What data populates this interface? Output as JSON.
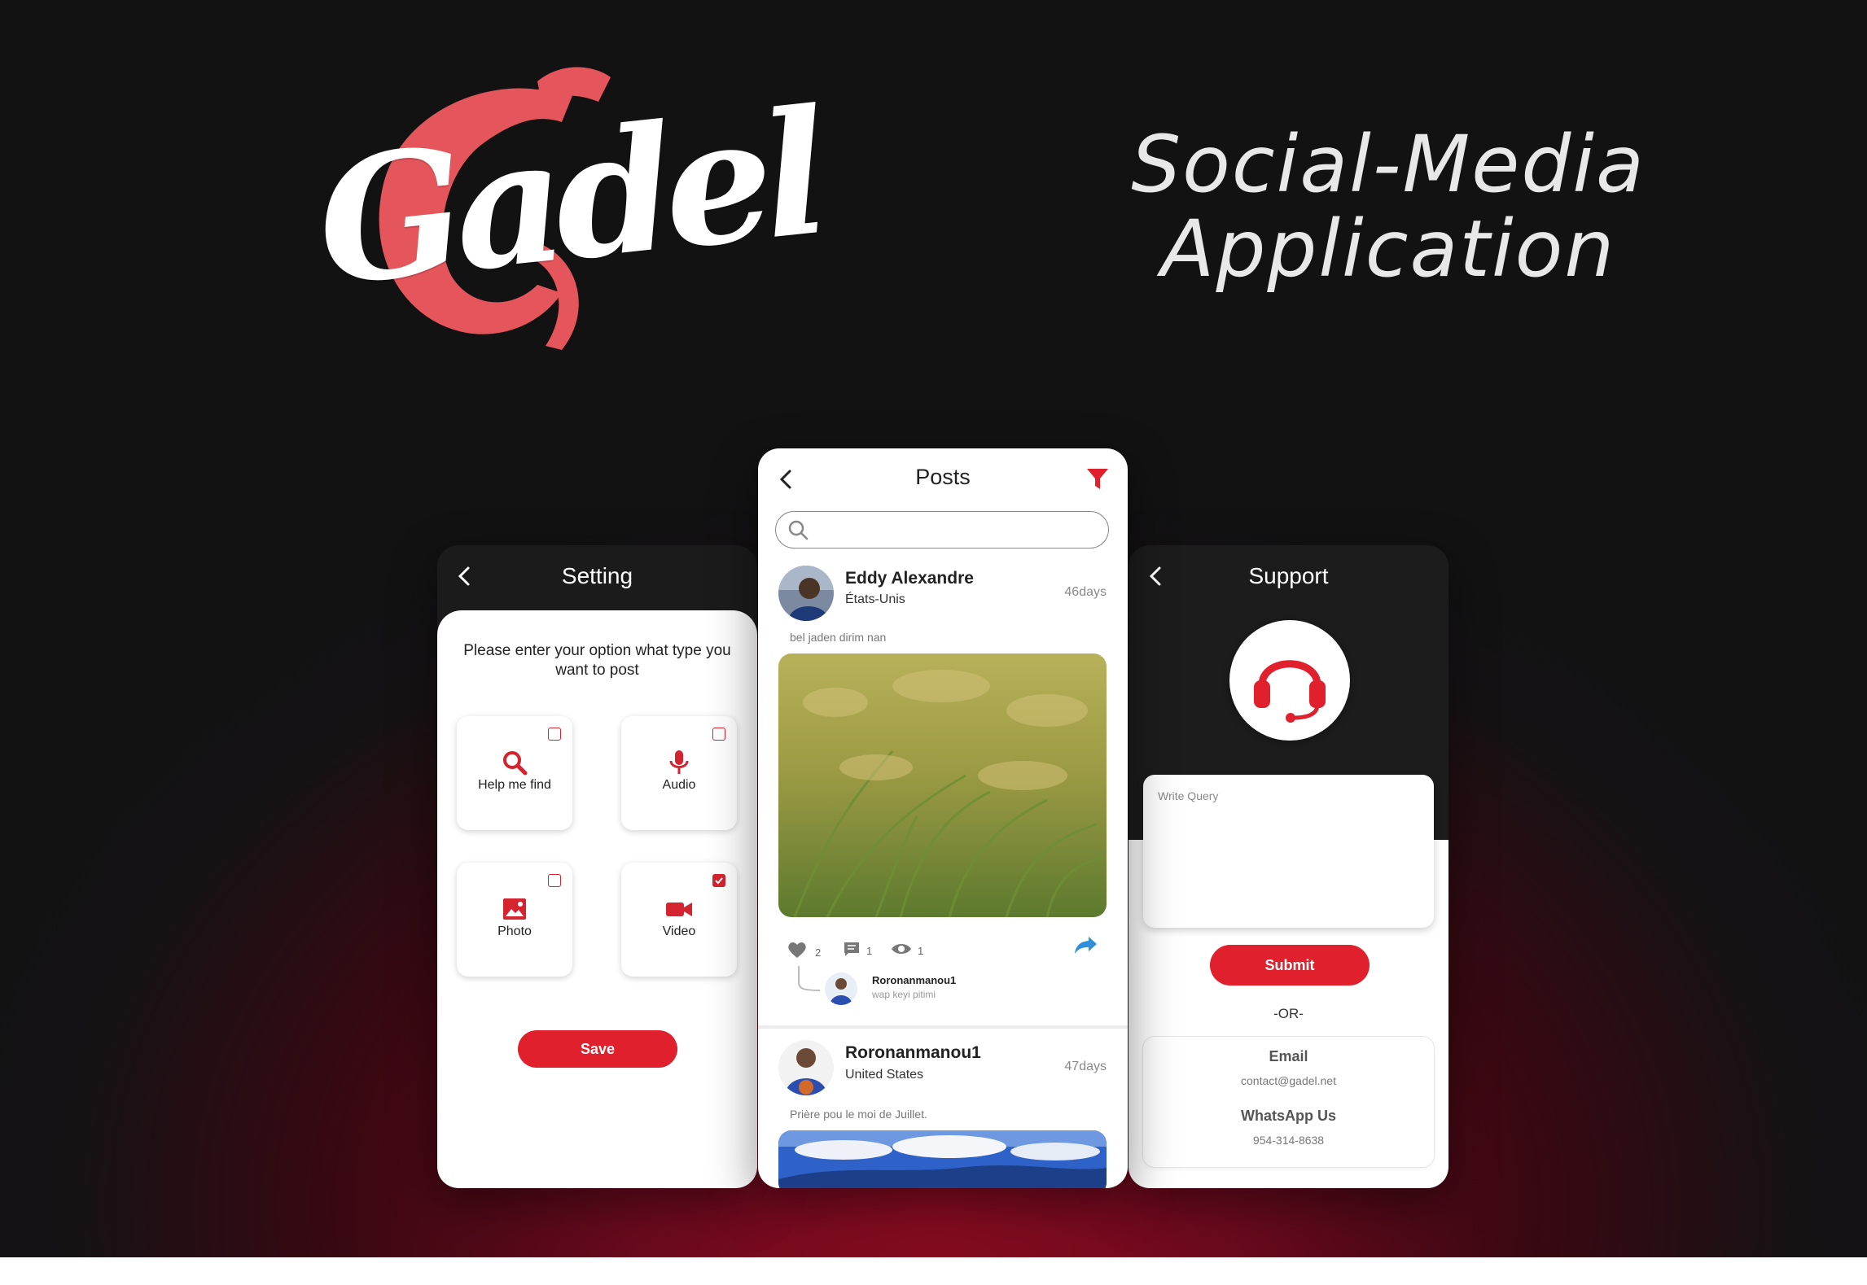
{
  "brand": {
    "logo_text": "Gadel",
    "headline_line1": "Social-Media",
    "headline_line2": "Application",
    "accent": "#e0202c"
  },
  "setting_screen": {
    "title": "Setting",
    "prompt": "Please enter your option what type you want to post",
    "options": [
      {
        "label": "Help me find",
        "icon": "search-icon",
        "checked": false
      },
      {
        "label": "Audio",
        "icon": "microphone-icon",
        "checked": false
      },
      {
        "label": "Photo",
        "icon": "image-icon",
        "checked": false
      },
      {
        "label": "Video",
        "icon": "video-camera-icon",
        "checked": true
      }
    ],
    "save_label": "Save"
  },
  "posts_screen": {
    "title": "Posts",
    "search_placeholder": "",
    "posts": [
      {
        "user": "Eddy Alexandre",
        "location": "États-Unis",
        "age": "46days",
        "caption": "bel jaden dirim nan",
        "likes": "2",
        "comments": "1",
        "views": "1",
        "comment": {
          "user": "Roronanmanou1",
          "text": "wap keyi pitimi"
        }
      },
      {
        "user": "Roronanmanou1",
        "location": "United States",
        "age": "47days",
        "caption": "Prière pou le moi de Juillet."
      }
    ]
  },
  "support_screen": {
    "title": "Support",
    "query_placeholder": "Write Query",
    "submit_label": "Submit",
    "or_text": "-OR-",
    "email_label": "Email",
    "email_value": "contact@gadel.net",
    "whatsapp_label": "WhatsApp Us",
    "whatsapp_value": "954-314-8638"
  }
}
